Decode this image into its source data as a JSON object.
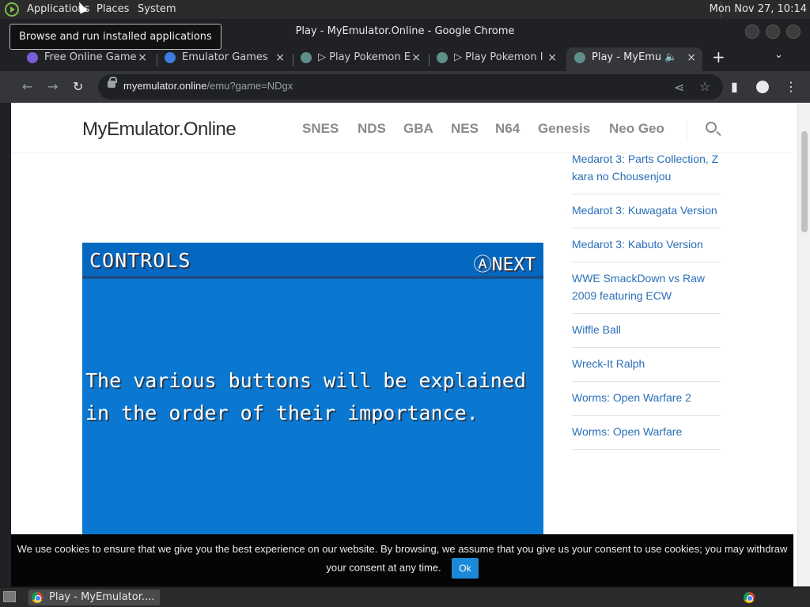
{
  "top_panel": {
    "applications": "Applications",
    "places": "Places",
    "system": "System",
    "clock": "Mon Nov 27, 10:14"
  },
  "tooltip": "Browse and run installed applications",
  "window": {
    "title": "Play - MyEmulator.Online - Google Chrome"
  },
  "tabs": [
    {
      "label": "Free Online Game",
      "close": "×"
    },
    {
      "label": "Emulator Games",
      "close": "×"
    },
    {
      "label": "▷ Play Pokemon E",
      "close": "×"
    },
    {
      "label": "▷ Play Pokemon I",
      "close": "×"
    },
    {
      "label": "Play - MyEmu",
      "close": "×"
    }
  ],
  "new_tab": "+",
  "address": {
    "domain": "myemulator.online",
    "path": "/emu?game=NDgx"
  },
  "site": {
    "brand": "MyEmulator.Online",
    "nav": [
      "SNES",
      "NDS",
      "GBA",
      "NES",
      "N64",
      "Genesis",
      "Neo Geo"
    ]
  },
  "game": {
    "title": "CONTROLS",
    "next": "ⒶNEXT",
    "text": "The various buttons will be explained in the order of their importance."
  },
  "sidebar": [
    "Medarot 3: Parts Collection, Z kara no Chousenjou",
    "Medarot 3: Kuwagata Version",
    "Medarot 3: Kabuto Version",
    "WWE SmackDown vs Raw 2009 featuring ECW",
    "Wiffle Ball",
    "Wreck-It Ralph",
    "Worms: Open Warfare 2",
    "Worms: Open Warfare"
  ],
  "cookie": {
    "text": "We use cookies to ensure that we give you the best experience on our website. By browsing, we assume that you give us your consent to use cookies; you may withdraw your consent at any time.",
    "ok": "Ok"
  },
  "taskbar": {
    "window_button": "Play - MyEmulator...."
  }
}
